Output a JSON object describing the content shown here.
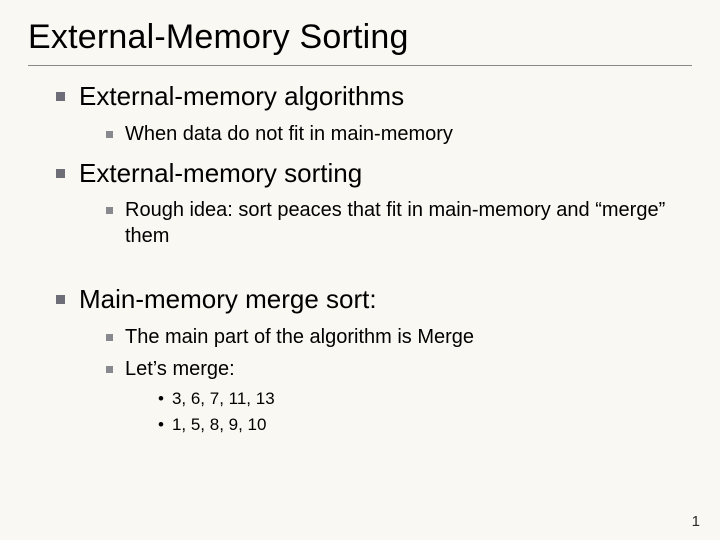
{
  "title": "External-Memory Sorting",
  "sections": [
    {
      "heading": "External-memory algorithms",
      "subs": [
        {
          "text": "When data do not fit in main-memory"
        }
      ]
    },
    {
      "heading": "External-memory sorting",
      "subs": [
        {
          "text": "Rough idea: sort peaces that fit in main-memory and “merge” them"
        }
      ]
    },
    {
      "heading": "Main-memory merge sort:",
      "subs": [
        {
          "text": "The main part of the algorithm is Merge"
        },
        {
          "text": "Let’s merge:",
          "subsubs": [
            "3, 6, 7, 11, 13",
            "1, 5, 8, 9, 10"
          ]
        }
      ]
    }
  ],
  "page_number": "1"
}
